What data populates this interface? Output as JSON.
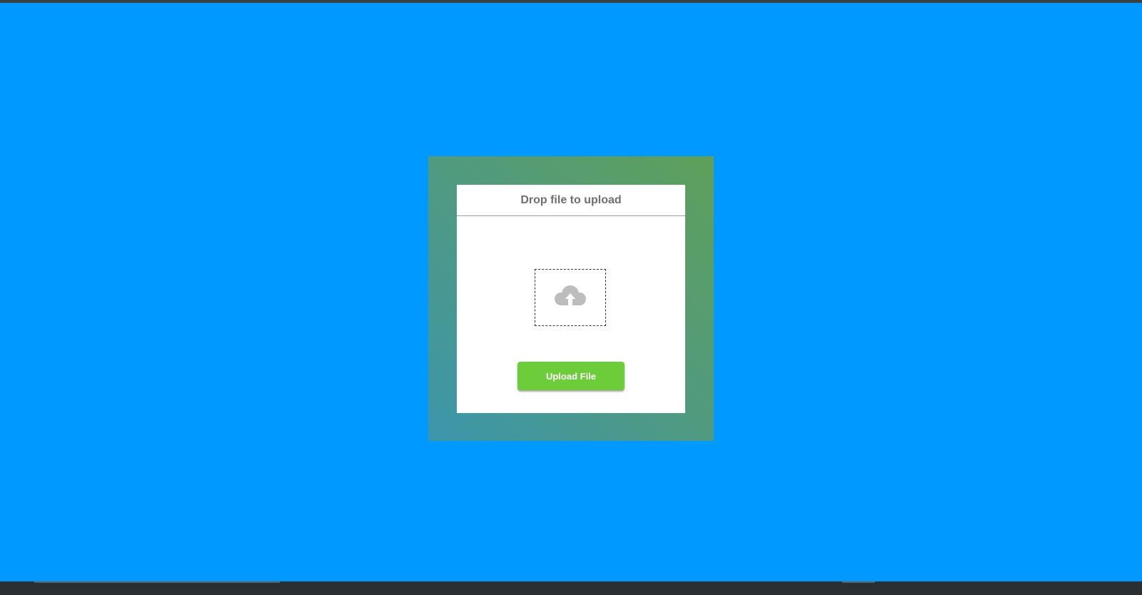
{
  "theme": {
    "background": "#0099ff",
    "frame_gradient": [
      "#3c96ac",
      "#509a80",
      "#5ea05a"
    ],
    "button_color": "#6dcc3a",
    "icon_color": "#bdbdbd"
  },
  "uploader": {
    "title": "Drop file to upload",
    "drop_icon": "cloud-upload-icon",
    "button_label": "Upload File"
  }
}
